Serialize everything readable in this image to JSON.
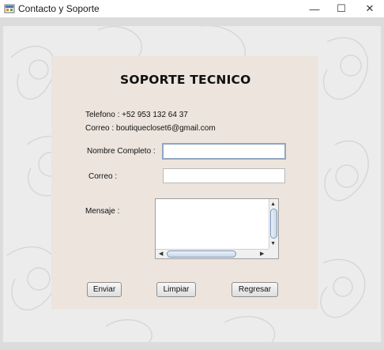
{
  "window": {
    "title": "Contacto y Soporte",
    "minimize_glyph": "—",
    "maximize_glyph": "☐",
    "close_glyph": "✕"
  },
  "panel": {
    "heading": "SOPORTE TECNICO",
    "phone_info": "Telefono : +52 953 132 64 37",
    "email_info": "Correo : boutiquecloset6@gmail.com"
  },
  "form": {
    "name_label": "Nombre Completo :",
    "name_value": "",
    "email_label": "Correo :",
    "email_value": "",
    "message_label": "Mensaje :",
    "message_value": ""
  },
  "buttons": {
    "send": "Enviar",
    "clear": "Limpiar",
    "back": "Regresar"
  },
  "colors": {
    "panel": "#ece4dd",
    "focus_border": "#8fa6c4"
  }
}
